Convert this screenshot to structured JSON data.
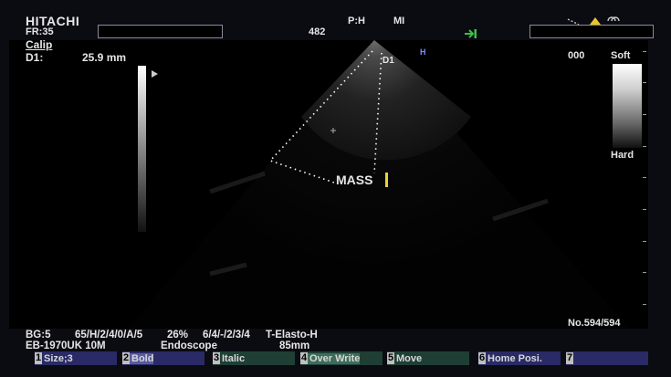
{
  "header": {
    "brand": "HITACHI",
    "frame_rate": "FR:35",
    "ph_label": "P:H",
    "mi_label": "MI",
    "center_value": "482",
    "caliper_label": "Calip",
    "d1_label": "D1:",
    "d1_value": "25.9 mm",
    "counter": "000"
  },
  "elasto_scale": {
    "top_label": "Soft",
    "bottom_label": "Hard"
  },
  "image": {
    "d1_marker": "D1",
    "h_marker": "H",
    "annotation": "MASS",
    "frame_counter": "No.594/594"
  },
  "status": {
    "line1": [
      {
        "id": "bg",
        "text": "BG:5"
      },
      {
        "id": "params",
        "text": "65/H/2/4/0/A/5"
      },
      {
        "id": "gain",
        "text": "26%"
      },
      {
        "id": "mode_params",
        "text": "6/4/-/2/3/4"
      },
      {
        "id": "mode",
        "text": "T-Elasto-H"
      }
    ],
    "line2": [
      {
        "id": "probe",
        "text": "EB-1970UK 10M"
      },
      {
        "id": "app",
        "text": "Endoscope"
      },
      {
        "id": "depth",
        "text": "85mm"
      }
    ]
  },
  "function_keys": [
    {
      "num": "1",
      "label": "Size;3"
    },
    {
      "num": "2",
      "label": "Bold"
    },
    {
      "num": "3",
      "label": "Italic"
    },
    {
      "num": "4",
      "label": "Over Write"
    },
    {
      "num": "5",
      "label": "Move"
    },
    {
      "num": "6",
      "label": "Home Posi."
    },
    {
      "num": "7",
      "label": ""
    }
  ],
  "colors": {
    "annotation_cursor": "#e8d23a",
    "arrow_icon": "#3fbf4a",
    "fkey_blue": "#2a2a66",
    "fkey_green": "#1f3f35"
  }
}
